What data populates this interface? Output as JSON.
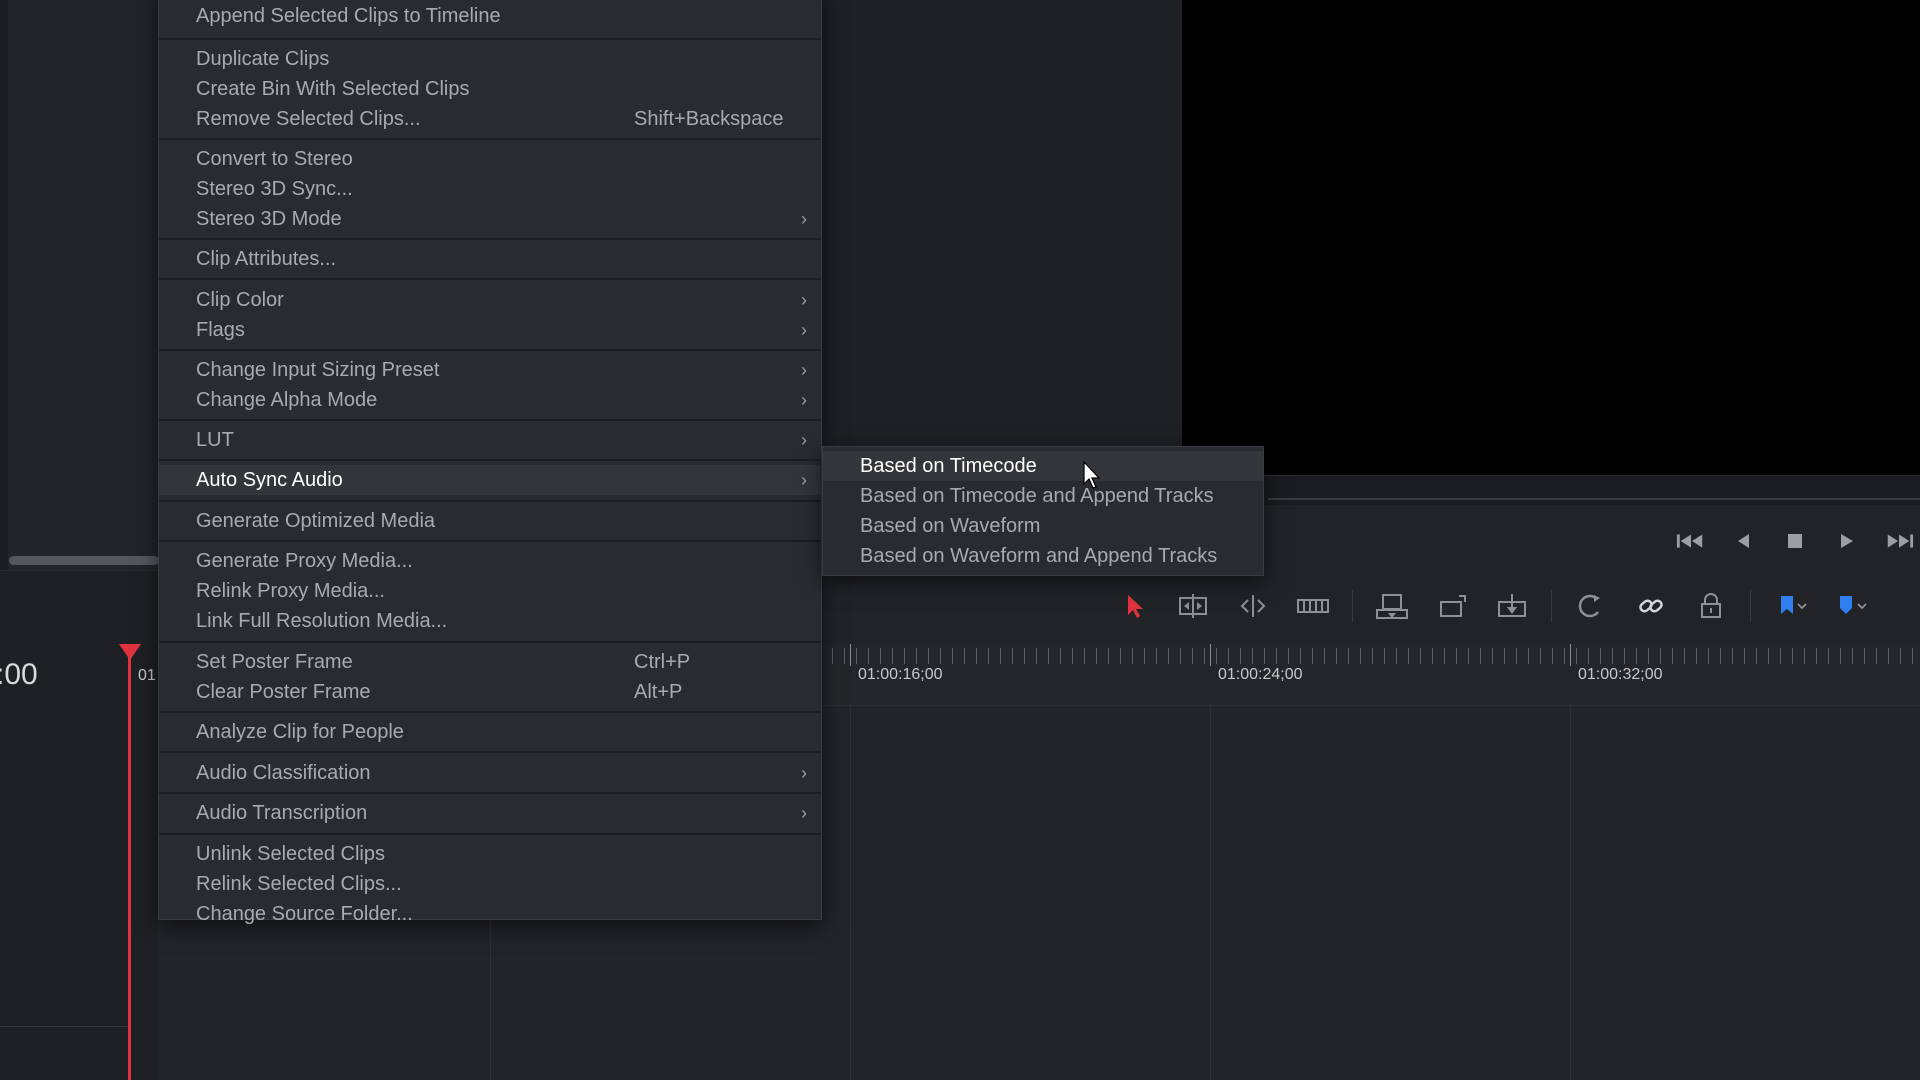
{
  "context_menu": {
    "items": [
      {
        "label": "Append Selected Clips to Timeline",
        "shortcut": "",
        "submenu": false
      },
      {
        "label": "Duplicate Clips",
        "shortcut": "",
        "submenu": false
      },
      {
        "label": "Create Bin With Selected Clips",
        "shortcut": "",
        "submenu": false
      },
      {
        "label": "Remove Selected Clips...",
        "shortcut": "Shift+Backspace",
        "submenu": false
      },
      {
        "label": "Convert to Stereo",
        "shortcut": "",
        "submenu": false
      },
      {
        "label": "Stereo 3D Sync...",
        "shortcut": "",
        "submenu": false
      },
      {
        "label": "Stereo 3D Mode",
        "shortcut": "",
        "submenu": true
      },
      {
        "label": "Clip Attributes...",
        "shortcut": "",
        "submenu": false
      },
      {
        "label": "Clip Color",
        "shortcut": "",
        "submenu": true
      },
      {
        "label": "Flags",
        "shortcut": "",
        "submenu": true
      },
      {
        "label": "Change Input Sizing Preset",
        "shortcut": "",
        "submenu": true
      },
      {
        "label": "Change Alpha Mode",
        "shortcut": "",
        "submenu": true
      },
      {
        "label": "LUT",
        "shortcut": "",
        "submenu": true
      },
      {
        "label": "Auto Sync Audio",
        "shortcut": "",
        "submenu": true
      },
      {
        "label": "Generate Optimized Media",
        "shortcut": "",
        "submenu": false
      },
      {
        "label": "Generate Proxy Media...",
        "shortcut": "",
        "submenu": false
      },
      {
        "label": "Relink Proxy Media...",
        "shortcut": "",
        "submenu": false
      },
      {
        "label": "Link Full Resolution Media...",
        "shortcut": "",
        "submenu": false
      },
      {
        "label": "Set Poster Frame",
        "shortcut": "Ctrl+P",
        "submenu": false
      },
      {
        "label": "Clear Poster Frame",
        "shortcut": "Alt+P",
        "submenu": false
      },
      {
        "label": "Analyze Clip for People",
        "shortcut": "",
        "submenu": false
      },
      {
        "label": "Audio Classification",
        "shortcut": "",
        "submenu": true
      },
      {
        "label": "Audio Transcription",
        "shortcut": "",
        "submenu": true
      },
      {
        "label": "Unlink Selected Clips",
        "shortcut": "",
        "submenu": false
      },
      {
        "label": "Relink Selected Clips...",
        "shortcut": "",
        "submenu": false
      },
      {
        "label": "Change Source Folder...",
        "shortcut": "",
        "submenu": false
      }
    ],
    "active_item": "Auto Sync Audio",
    "chevron": "›"
  },
  "submenu": {
    "items": [
      {
        "label": "Based on Timecode"
      },
      {
        "label": "Based on Timecode and Append Tracks"
      },
      {
        "label": "Based on Waveform"
      },
      {
        "label": "Based on Waveform and Append Tracks"
      }
    ],
    "active_item": "Based on Timecode"
  },
  "timeline": {
    "timecode_partial": ":00",
    "playhead_label_partial": "01",
    "ruler_labels": [
      "01:00:16;00",
      "01:00:24;00",
      "01:00:32;00"
    ]
  },
  "transport": {
    "icons": [
      "skip-to-start-icon",
      "reverse-play-icon",
      "stop-icon",
      "play-icon",
      "skip-to-end-icon"
    ]
  },
  "toolbar": {
    "icons": [
      "selection-mode-icon",
      "trim-edit-icon",
      "dynamic-trim-icon",
      "blade-edit-icon",
      "insert-clip-icon",
      "overwrite-clip-icon",
      "replace-clip-icon",
      "snapping-icon",
      "linked-selection-icon",
      "position-lock-icon",
      "flag-icon",
      "marker-icon"
    ],
    "accent_color": "#e0333f",
    "flag_color": "#2f7ff0"
  }
}
